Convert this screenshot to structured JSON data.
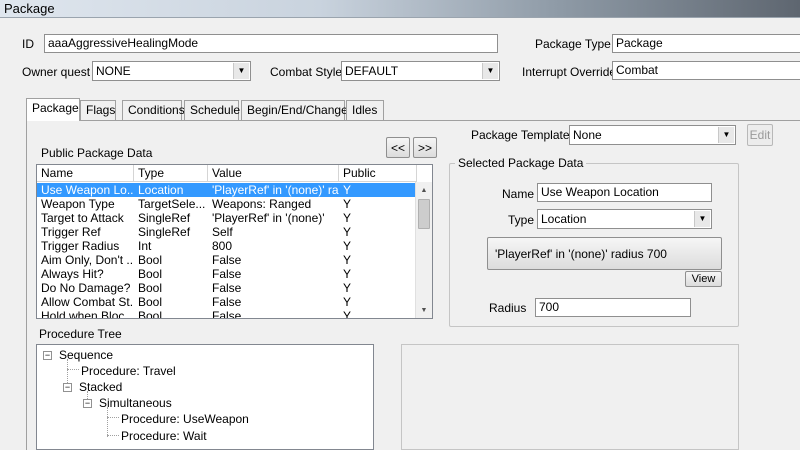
{
  "window": {
    "title": "Package"
  },
  "header": {
    "id_label": "ID",
    "id_value": "aaaAggressiveHealingMode",
    "package_type_label": "Package Type",
    "package_type_value": "Package",
    "owner_quest_label": "Owner quest",
    "owner_quest_value": "NONE",
    "combat_style_label": "Combat Style",
    "combat_style_value": "DEFAULT",
    "interrupt_override_label": "Interrupt Override",
    "interrupt_override_value": "Combat"
  },
  "tabs": [
    {
      "label": "Package",
      "active": true
    },
    {
      "label": "Flags",
      "active": false
    },
    {
      "label": "Conditions",
      "active": false
    },
    {
      "label": "Schedule",
      "active": false
    },
    {
      "label": "Begin/End/Change",
      "active": false
    },
    {
      "label": "Idles",
      "active": false
    }
  ],
  "public_data": {
    "label": "Public Package Data",
    "prev_button": "<<",
    "next_button": ">>",
    "columns": [
      "Name",
      "Type",
      "Value",
      "Public"
    ],
    "rows": [
      {
        "name": "Use Weapon Lo...",
        "type": "Location",
        "value": "'PlayerRef' in '(none)' ra...",
        "public": "Y",
        "selected": true
      },
      {
        "name": "Weapon Type",
        "type": "TargetSele...",
        "value": "Weapons: Ranged",
        "public": "Y"
      },
      {
        "name": "Target to Attack",
        "type": "SingleRef",
        "value": "'PlayerRef' in '(none)'",
        "public": "Y"
      },
      {
        "name": "Trigger Ref",
        "type": "SingleRef",
        "value": "Self",
        "public": "Y"
      },
      {
        "name": "Trigger Radius",
        "type": "Int",
        "value": "800",
        "public": "Y"
      },
      {
        "name": "Aim Only, Don't ...",
        "type": "Bool",
        "value": "False",
        "public": "Y"
      },
      {
        "name": "Always Hit?",
        "type": "Bool",
        "value": "False",
        "public": "Y"
      },
      {
        "name": "Do No Damage?",
        "type": "Bool",
        "value": "False",
        "public": "Y"
      },
      {
        "name": "Allow Combat St...",
        "type": "Bool",
        "value": "False",
        "public": "Y"
      },
      {
        "name": "Hold when Bloc...",
        "type": "Bool",
        "value": "False",
        "public": "Y"
      }
    ]
  },
  "package_template": {
    "label": "Package Template",
    "value": "None",
    "edit_button": "Edit"
  },
  "selected_data": {
    "group_label": "Selected Package Data",
    "name_label": "Name",
    "name_value": "Use Weapon Location",
    "type_label": "Type",
    "type_value": "Location",
    "location_button": "'PlayerRef' in '(none)' radius 700",
    "view_button": "View",
    "radius_label": "Radius",
    "radius_value": "700"
  },
  "procedure_tree": {
    "label": "Procedure Tree",
    "nodes": [
      {
        "label": "Sequence"
      },
      {
        "label": "Procedure: Travel"
      },
      {
        "label": "Stacked"
      },
      {
        "label": "Simultaneous"
      },
      {
        "label": "Procedure: UseWeapon"
      },
      {
        "label": "Procedure: Wait"
      }
    ]
  },
  "colors": {
    "selection": "#3399ff",
    "window_bg": "#f0f0f0"
  }
}
